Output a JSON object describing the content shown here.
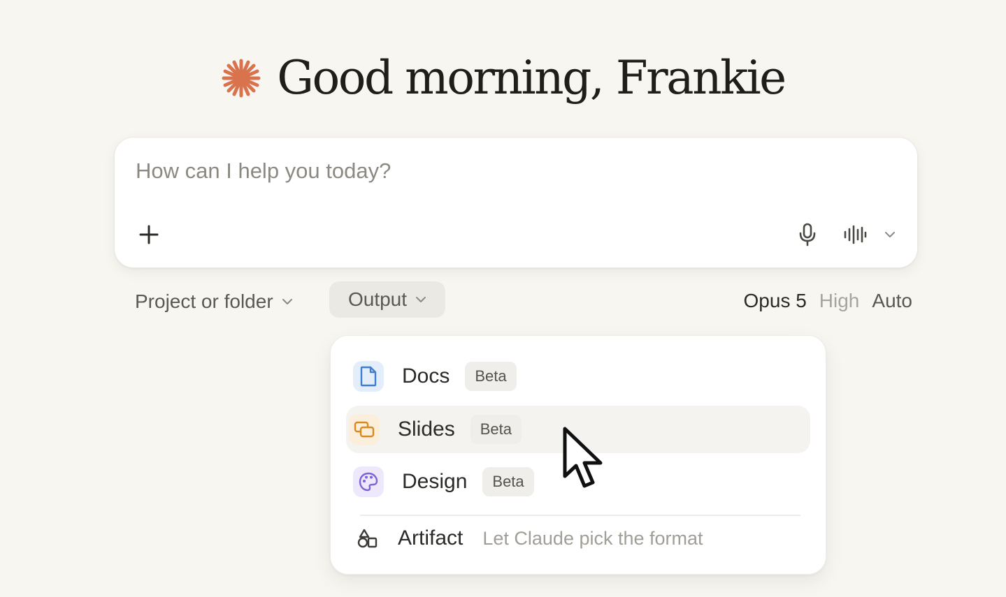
{
  "greeting": {
    "text": "Good morning, Frankie",
    "logo_icon": "claude-starburst-icon",
    "logo_color": "#d9734e"
  },
  "composer": {
    "placeholder": "How can I help you today?",
    "value": "",
    "attach_icon": "plus-icon",
    "mic_icon": "microphone-icon",
    "voice_icon": "voice-waveform-icon",
    "voice_menu_icon": "chevron-down-icon"
  },
  "toolbar": {
    "project_label": "Project or folder",
    "output_label": "Output",
    "model": "Opus 5",
    "effort": "High",
    "mode": "Auto"
  },
  "output_menu": {
    "items": [
      {
        "label": "Docs",
        "badge": "Beta",
        "icon": "document-icon",
        "icon_color": "#3f7fd1"
      },
      {
        "label": "Slides",
        "badge": "Beta",
        "icon": "slides-icon",
        "icon_color": "#d88a1e"
      },
      {
        "label": "Design",
        "badge": "Beta",
        "icon": "palette-icon",
        "icon_color": "#7d64d6"
      }
    ],
    "artifact": {
      "label": "Artifact",
      "description": "Let Claude pick the format",
      "icon": "shapes-icon"
    },
    "highlighted": "Slides"
  },
  "colors": {
    "background": "#f8f6f1",
    "accent": "#d9734e"
  }
}
